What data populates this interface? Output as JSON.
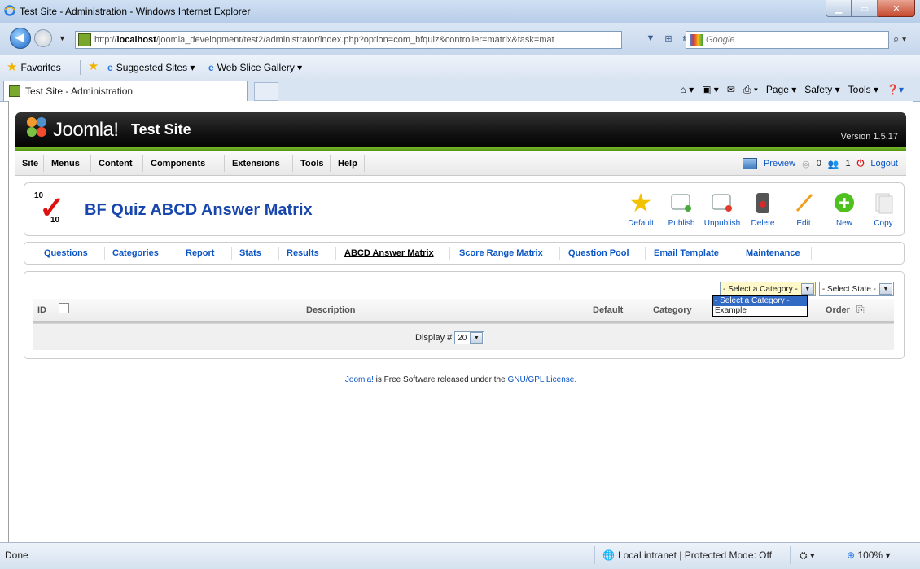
{
  "window": {
    "title": "Test Site - Administration - Windows Internet Explorer"
  },
  "address": {
    "url_prefix": "http://",
    "url_host": "localhost",
    "url_rest": "/joomla_development/test2/administrator/index.php?option=com_bfquiz&controller=matrix&task=mat",
    "search_placeholder": "Google"
  },
  "favorites": {
    "favorites_label": "Favorites",
    "suggested_label": "Suggested Sites ▾",
    "webslice_label": "Web Slice Gallery ▾"
  },
  "tab": {
    "title": "Test Site - Administration"
  },
  "commandbar": {
    "page": "Page ▾",
    "safety": "Safety ▾",
    "tools": "Tools ▾"
  },
  "joomla": {
    "brand": "Joomla!",
    "site_name": "Test Site",
    "version": "Version 1.5.17",
    "menu": [
      "Site",
      "Menus",
      "Content",
      "Components",
      "Extensions",
      "Tools",
      "Help"
    ],
    "status": {
      "preview": "Preview",
      "messages": "0",
      "users": "1",
      "logout": "Logout"
    }
  },
  "toolbar": {
    "logo_top": "10",
    "logo_bottom": "10",
    "title": "BF Quiz ABCD Answer Matrix",
    "buttons": [
      "Default",
      "Publish",
      "Unpublish",
      "Delete",
      "Edit",
      "New",
      "Copy"
    ]
  },
  "subnav": {
    "items": [
      "Questions",
      "Categories",
      "Report",
      "Stats",
      "Results",
      "ABCD Answer Matrix",
      "Score Range Matrix",
      "Question Pool",
      "Email Template",
      "Maintenance"
    ],
    "active": "ABCD Answer Matrix"
  },
  "filters": {
    "category_selected": "- Select a Category -",
    "category_options": [
      "- Select a Category -",
      "Example"
    ],
    "state_selected": "- Select State -"
  },
  "table": {
    "columns": {
      "id": "ID",
      "description": "Description",
      "default": "Default",
      "category": "Category",
      "order": "Order"
    },
    "display_label": "Display #",
    "display_value": "20"
  },
  "footer": {
    "link1": "Joomla!",
    "text": " is Free Software released under the ",
    "link2": "GNU/GPL License."
  },
  "statusbar": {
    "done": "Done",
    "zone": "Local intranet | Protected Mode: Off",
    "zoom": "100%"
  },
  "colors": {
    "joomla_green": "#5aa01a",
    "link_blue": "#0b55c4",
    "title_blue": "#1846ad"
  }
}
